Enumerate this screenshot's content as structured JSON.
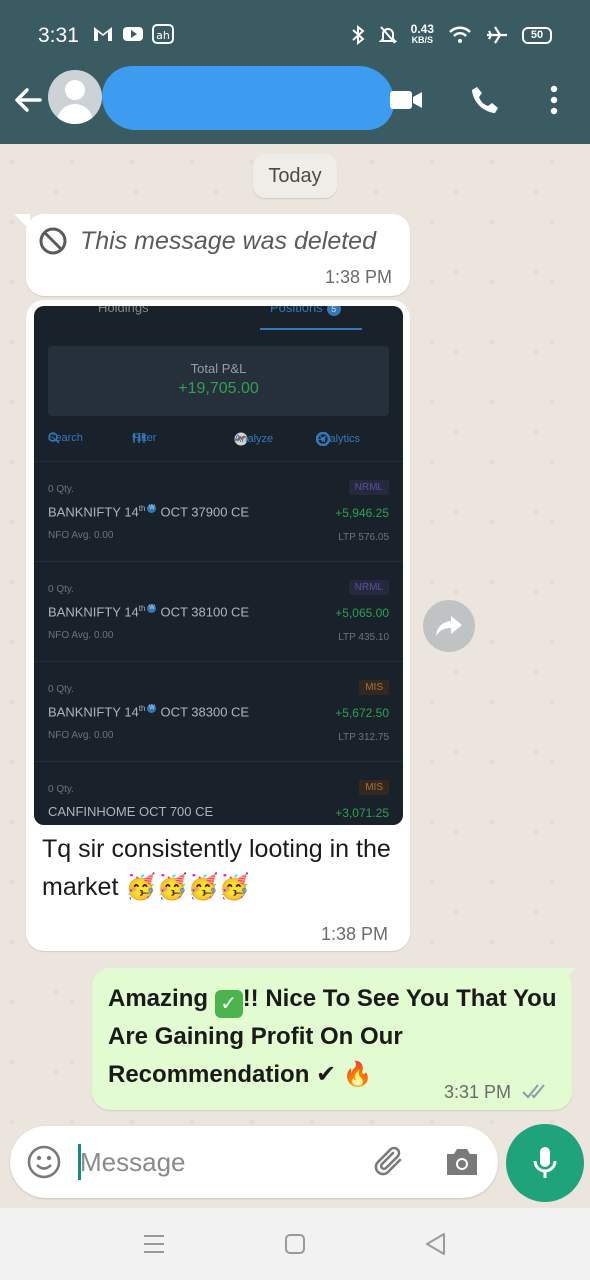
{
  "status_bar": {
    "time": "3:31",
    "net_speed": "0.43",
    "net_unit": "KB/S",
    "battery": "50",
    "icons": [
      "gmail-icon",
      "youtube-icon",
      "app-notification-icon",
      "bluetooth-icon",
      "mute-icon",
      "wifi-icon",
      "airplane-icon"
    ]
  },
  "header": {
    "back_icon": "arrow-back-icon",
    "contact_name_redacted": true,
    "actions": [
      "video-call-icon",
      "voice-call-icon",
      "more-options-icon"
    ]
  },
  "chat": {
    "date_chip": "Today",
    "messages": [
      {
        "direction": "incoming",
        "text": "This message was deleted",
        "time": "1:38 PM"
      },
      {
        "direction": "incoming",
        "image": {
          "tabs": [
            "Holdings",
            "Positions"
          ],
          "positions_count": "5",
          "total_pnl_label": "Total P&L",
          "total_pnl_value": "+19,705.00",
          "toolbar": [
            "Search",
            "Filter",
            "Analyze",
            "Analytics"
          ],
          "rows": [
            {
              "qty": "0 Qty.",
              "name_pre": "BANKNIFTY 14",
              "sup": "th",
              "name_post": "OCT 37900 CE",
              "meta": "NFO  Avg. 0.00",
              "tag": "NRML",
              "pnl": "+5,946.25",
              "ltp": "LTP 576.05"
            },
            {
              "qty": "0 Qty.",
              "name_pre": "BANKNIFTY 14",
              "sup": "th",
              "name_post": "OCT 38100 CE",
              "meta": "NFO  Avg. 0.00",
              "tag": "NRML",
              "pnl": "+5,065.00",
              "ltp": "LTP 435.10"
            },
            {
              "qty": "0 Qty.",
              "name_pre": "BANKNIFTY 14",
              "sup": "th",
              "name_post": "OCT 38300 CE",
              "meta": "NFO  Avg. 0.00",
              "tag": "MIS",
              "pnl": "+5,672.50",
              "ltp": "LTP 312.75"
            },
            {
              "qty": "0 Qty.",
              "name_pre": "CANFINHOME OCT 700 CE",
              "sup": "",
              "name_post": "",
              "meta": "",
              "tag": "MIS",
              "pnl": "+3,071.25",
              "ltp": ""
            }
          ]
        },
        "caption": "Tq sir consistently looting in the market 🥳🥳🥳🥳",
        "time": "1:38 PM"
      },
      {
        "direction": "outgoing",
        "text_part1": "Amazing ",
        "text_part2": "!! Nice   To See You That You Are Gaining Profit On  Our Recommendation ✔ 🔥",
        "check_emoji": "✓",
        "time": "3:31 PM",
        "read_status": "double-tick"
      }
    ]
  },
  "input": {
    "placeholder": "Message"
  },
  "colors": {
    "header_bg": "#3a5b62",
    "chat_bg": "#ece5dd",
    "outgoing_bubble": "#e2fbd0",
    "accent": "#1ea37a"
  }
}
